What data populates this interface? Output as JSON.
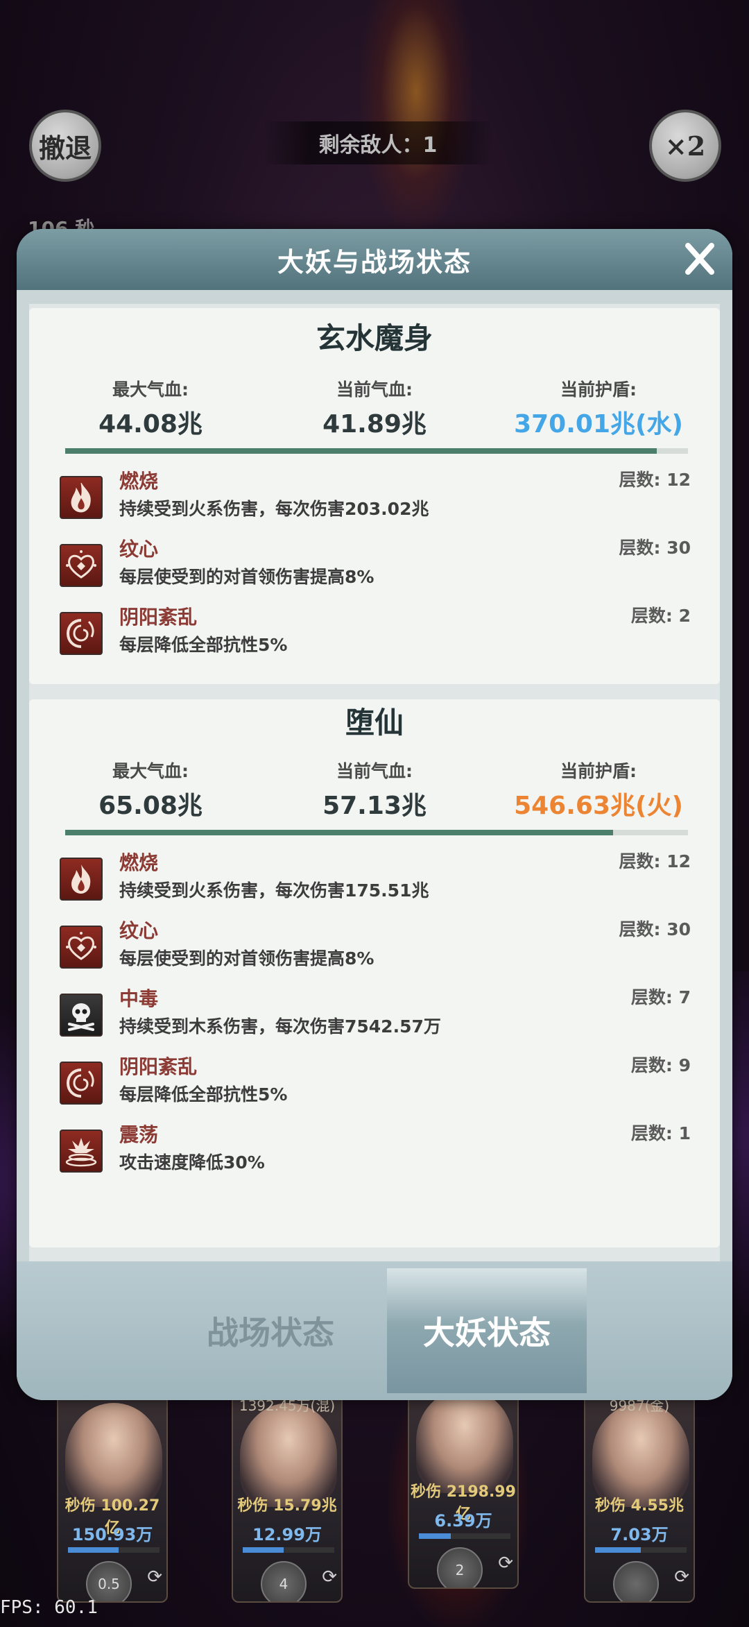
{
  "game_hud": {
    "retreat_label": "撤退",
    "speed_label": "×2",
    "enemies_left": "剩余敌人：1",
    "timer": "106 秒",
    "fps": "FPS: 60.1"
  },
  "characters": [
    {
      "top_note": "",
      "dps": "秒伤 100.27亿",
      "hp": "150.93万",
      "hp_fraction": 0.55,
      "skill": "0.5"
    },
    {
      "top_note": "1392.45万(混)",
      "dps": "秒伤 15.79兆",
      "hp": "12.99万",
      "hp_fraction": 0.45,
      "skill": "4"
    },
    {
      "top_note": "",
      "dps": "秒伤 2198.99亿",
      "hp": "6.39万",
      "hp_fraction": 0.35,
      "skill": "2"
    },
    {
      "top_note": "9987(金)",
      "dps": "秒伤 4.55兆",
      "hp": "7.03万",
      "hp_fraction": 0.5,
      "skill": ""
    }
  ],
  "modal": {
    "title": "大妖与战场状态",
    "close_label": "X",
    "labels": {
      "max_hp": "最大气血:",
      "cur_hp": "当前气血:",
      "shield": "当前护盾:",
      "stacks_prefix": "层数: "
    },
    "bosses": [
      {
        "name": "玄水魔身",
        "max_hp": "44.08兆",
        "cur_hp": "41.89兆",
        "shield": "370.01兆(水)",
        "shield_color": "#44a6e6",
        "hp_fraction": 0.95,
        "effects": [
          {
            "icon": "flame-icon",
            "name": "燃烧",
            "desc": "持续受到火系伤害，每次伤害203.02兆",
            "stacks": "层数: 12"
          },
          {
            "icon": "heart-mark-icon",
            "name": "纹心",
            "desc": "每层使受到的对首领伤害提高8%",
            "stacks": "层数: 30"
          },
          {
            "icon": "yin-yang-swirl-icon",
            "name": "阴阳紊乱",
            "desc": "每层降低全部抗性5%",
            "stacks": "层数: 2"
          }
        ]
      },
      {
        "name": "堕仙",
        "max_hp": "65.08兆",
        "cur_hp": "57.13兆",
        "shield": "546.63兆(火)",
        "shield_color": "#ec8533",
        "hp_fraction": 0.88,
        "effects": [
          {
            "icon": "flame-icon",
            "name": "燃烧",
            "desc": "持续受到火系伤害，每次伤害175.51兆",
            "stacks": "层数: 12"
          },
          {
            "icon": "heart-mark-icon",
            "name": "纹心",
            "desc": "每层使受到的对首领伤害提高8%",
            "stacks": "层数: 30"
          },
          {
            "icon": "skull-icon",
            "name": "中毒",
            "desc": "持续受到木系伤害，每次伤害7542.57万",
            "stacks": "层数: 7"
          },
          {
            "icon": "yin-yang-swirl-icon",
            "name": "阴阳紊乱",
            "desc": "每层降低全部抗性5%",
            "stacks": "层数: 9"
          },
          {
            "icon": "shockwave-icon",
            "name": "震荡",
            "desc": "攻击速度降低30%",
            "stacks": "层数: 1"
          }
        ]
      }
    ],
    "tabs": [
      {
        "label": "战场状态",
        "active": false
      },
      {
        "label": "大妖状态",
        "active": true
      }
    ]
  }
}
